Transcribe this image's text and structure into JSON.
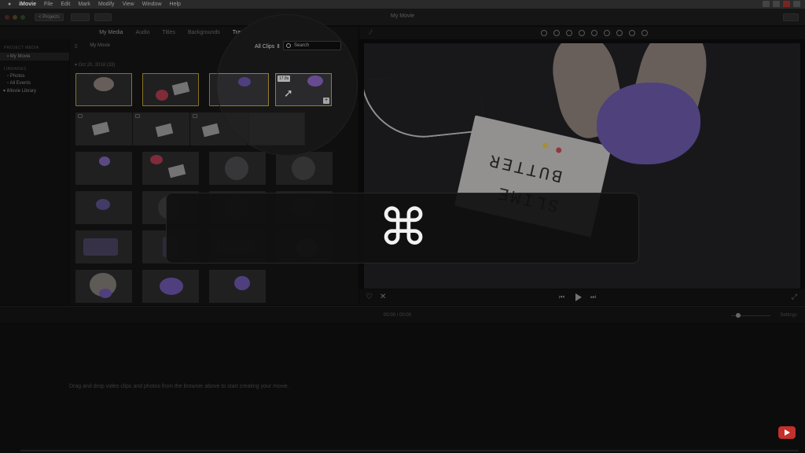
{
  "menubar": {
    "apple": "",
    "items": [
      "iMovie",
      "File",
      "Edit",
      "Mark",
      "Modify",
      "View",
      "Window",
      "Help"
    ]
  },
  "toolbar": {
    "projects_label": "< Projects",
    "window_title": "My Movie"
  },
  "tabs": [
    "My Media",
    "Audio",
    "Titles",
    "Backgrounds",
    "Transitions"
  ],
  "sidebar": {
    "project_media_head": "PROJECT MEDIA",
    "project_item": "My Movie",
    "libraries_head": "LIBRARIES",
    "library_items": [
      "Photos",
      "All Events",
      "iMovie Library"
    ]
  },
  "browser": {
    "title": "My Movie",
    "filter": "All Clips",
    "search_placeholder": "Search",
    "date_header": "Oct 20, 2018  (33)"
  },
  "magnifier": {
    "clip_duration": "17.8s"
  },
  "viewer": {
    "box_text_line1": "BUTTER",
    "box_text_line2": "SLIME"
  },
  "timeline": {
    "timecode": "00:00  /  00:00",
    "settings": "Settings",
    "hint": "Drag and drop video clips and photos from the browser above to start creating your movie."
  },
  "hud": {
    "key_symbol": "⌘"
  },
  "colors": {
    "selection_border": "#c9a93a",
    "slime": "#6a57a6",
    "youtube_red": "#c4302b"
  }
}
